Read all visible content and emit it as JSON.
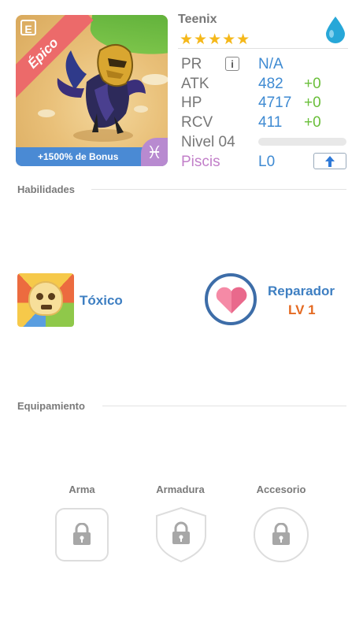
{
  "monster": {
    "name": "Teenix",
    "rarity": "Épico",
    "badge_letter": "E",
    "bonus": "+1500% de Bonus",
    "stars": "★★★★★",
    "element_icon": "water-drop-icon",
    "sign_symbol": "♓"
  },
  "stats": {
    "pr_label": "PR",
    "pr_value": "N/A",
    "atk_label": "ATK",
    "atk_value": "482",
    "atk_bonus": "+0",
    "hp_label": "HP",
    "hp_value": "4717",
    "hp_bonus": "+0",
    "rcv_label": "RCV",
    "rcv_value": "411",
    "rcv_bonus": "+0",
    "level_label": "Nivel 04",
    "level_progress": 0,
    "sign_label": "Piscis",
    "sign_value": "L0"
  },
  "abilities": {
    "title": "Habilidades",
    "items": [
      {
        "name": "Tóxico"
      },
      {
        "name": "Reparador",
        "level": "LV 1"
      }
    ]
  },
  "equipment": {
    "title": "Equipamiento",
    "slots": [
      {
        "label": "Arma",
        "shape": "rounded-square"
      },
      {
        "label": "Armadura",
        "shape": "shield"
      },
      {
        "label": "Accesorio",
        "shape": "circle"
      }
    ]
  },
  "colors": {
    "accent_blue": "#3e8ad2",
    "bonus_green": "#6abf3a",
    "rarity_red": "#ec6a6a",
    "level_orange": "#e46a22",
    "sign_purple": "#c27fc9"
  }
}
